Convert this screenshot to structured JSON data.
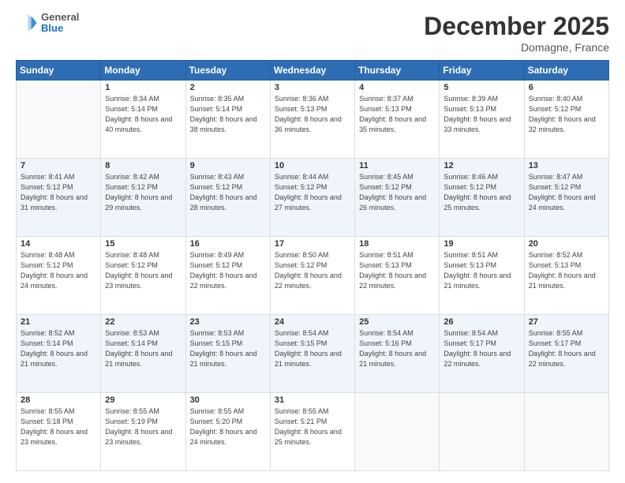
{
  "header": {
    "logo": {
      "general": "General",
      "blue": "Blue"
    },
    "title": "December 2025",
    "subtitle": "Domagne, France"
  },
  "calendar": {
    "weekdays": [
      "Sunday",
      "Monday",
      "Tuesday",
      "Wednesday",
      "Thursday",
      "Friday",
      "Saturday"
    ],
    "weeks": [
      [
        {
          "day": null
        },
        {
          "day": 1,
          "sunrise": "8:34 AM",
          "sunset": "5:14 PM",
          "daylight": "8 hours and 40 minutes."
        },
        {
          "day": 2,
          "sunrise": "8:35 AM",
          "sunset": "5:14 PM",
          "daylight": "8 hours and 38 minutes."
        },
        {
          "day": 3,
          "sunrise": "8:36 AM",
          "sunset": "5:13 PM",
          "daylight": "8 hours and 36 minutes."
        },
        {
          "day": 4,
          "sunrise": "8:37 AM",
          "sunset": "5:13 PM",
          "daylight": "8 hours and 35 minutes."
        },
        {
          "day": 5,
          "sunrise": "8:39 AM",
          "sunset": "5:13 PM",
          "daylight": "8 hours and 33 minutes."
        },
        {
          "day": 6,
          "sunrise": "8:40 AM",
          "sunset": "5:12 PM",
          "daylight": "8 hours and 32 minutes."
        }
      ],
      [
        {
          "day": 7,
          "sunrise": "8:41 AM",
          "sunset": "5:12 PM",
          "daylight": "8 hours and 31 minutes."
        },
        {
          "day": 8,
          "sunrise": "8:42 AM",
          "sunset": "5:12 PM",
          "daylight": "8 hours and 29 minutes."
        },
        {
          "day": 9,
          "sunrise": "8:43 AM",
          "sunset": "5:12 PM",
          "daylight": "8 hours and 28 minutes."
        },
        {
          "day": 10,
          "sunrise": "8:44 AM",
          "sunset": "5:12 PM",
          "daylight": "8 hours and 27 minutes."
        },
        {
          "day": 11,
          "sunrise": "8:45 AM",
          "sunset": "5:12 PM",
          "daylight": "8 hours and 26 minutes."
        },
        {
          "day": 12,
          "sunrise": "8:46 AM",
          "sunset": "5:12 PM",
          "daylight": "8 hours and 25 minutes."
        },
        {
          "day": 13,
          "sunrise": "8:47 AM",
          "sunset": "5:12 PM",
          "daylight": "8 hours and 24 minutes."
        }
      ],
      [
        {
          "day": 14,
          "sunrise": "8:48 AM",
          "sunset": "5:12 PM",
          "daylight": "8 hours and 24 minutes."
        },
        {
          "day": 15,
          "sunrise": "8:48 AM",
          "sunset": "5:12 PM",
          "daylight": "8 hours and 23 minutes."
        },
        {
          "day": 16,
          "sunrise": "8:49 AM",
          "sunset": "5:12 PM",
          "daylight": "8 hours and 22 minutes."
        },
        {
          "day": 17,
          "sunrise": "8:50 AM",
          "sunset": "5:12 PM",
          "daylight": "8 hours and 22 minutes."
        },
        {
          "day": 18,
          "sunrise": "8:51 AM",
          "sunset": "5:13 PM",
          "daylight": "8 hours and 22 minutes."
        },
        {
          "day": 19,
          "sunrise": "8:51 AM",
          "sunset": "5:13 PM",
          "daylight": "8 hours and 21 minutes."
        },
        {
          "day": 20,
          "sunrise": "8:52 AM",
          "sunset": "5:13 PM",
          "daylight": "8 hours and 21 minutes."
        }
      ],
      [
        {
          "day": 21,
          "sunrise": "8:52 AM",
          "sunset": "5:14 PM",
          "daylight": "8 hours and 21 minutes."
        },
        {
          "day": 22,
          "sunrise": "8:53 AM",
          "sunset": "5:14 PM",
          "daylight": "8 hours and 21 minutes."
        },
        {
          "day": 23,
          "sunrise": "8:53 AM",
          "sunset": "5:15 PM",
          "daylight": "8 hours and 21 minutes."
        },
        {
          "day": 24,
          "sunrise": "8:54 AM",
          "sunset": "5:15 PM",
          "daylight": "8 hours and 21 minutes."
        },
        {
          "day": 25,
          "sunrise": "8:54 AM",
          "sunset": "5:16 PM",
          "daylight": "8 hours and 21 minutes."
        },
        {
          "day": 26,
          "sunrise": "8:54 AM",
          "sunset": "5:17 PM",
          "daylight": "8 hours and 22 minutes."
        },
        {
          "day": 27,
          "sunrise": "8:55 AM",
          "sunset": "5:17 PM",
          "daylight": "8 hours and 22 minutes."
        }
      ],
      [
        {
          "day": 28,
          "sunrise": "8:55 AM",
          "sunset": "5:18 PM",
          "daylight": "8 hours and 23 minutes."
        },
        {
          "day": 29,
          "sunrise": "8:55 AM",
          "sunset": "5:19 PM",
          "daylight": "8 hours and 23 minutes."
        },
        {
          "day": 30,
          "sunrise": "8:55 AM",
          "sunset": "5:20 PM",
          "daylight": "8 hours and 24 minutes."
        },
        {
          "day": 31,
          "sunrise": "8:55 AM",
          "sunset": "5:21 PM",
          "daylight": "8 hours and 25 minutes."
        },
        {
          "day": null
        },
        {
          "day": null
        },
        {
          "day": null
        }
      ]
    ]
  }
}
